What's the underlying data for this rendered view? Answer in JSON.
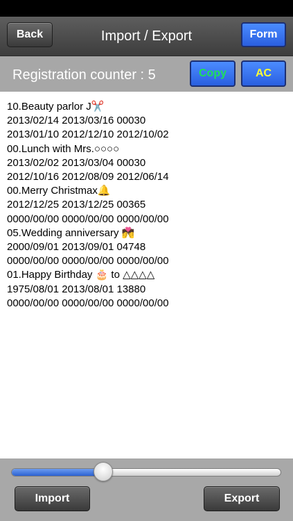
{
  "nav": {
    "back_label": "Back",
    "title": "Import / Export",
    "form_label": "Form"
  },
  "counter": {
    "label": "Registration counter : 5",
    "copy_label": "Copy",
    "ac_label": "AC"
  },
  "content": {
    "text": "10.Beauty parlor J✂️\n2013/02/14 2013/03/16 00030\n2013/01/10 2012/12/10 2012/10/02\n00.Lunch with Mrs.○○○○\n2013/02/02 2013/03/04 00030\n2012/10/16 2012/08/09 2012/06/14\n00.Merry Christmax🔔\n2012/12/25 2013/12/25 00365\n0000/00/00 0000/00/00 0000/00/00\n05.Wedding anniversary 💏\n2000/09/01 2013/09/01 04748\n0000/00/00 0000/00/00 0000/00/00\n01.Happy Birthday 🎂 to △△△△\n1975/08/01 2013/08/01 13880\n0000/00/00 0000/00/00 0000/00/00"
  },
  "slider": {
    "value_fraction": 0.34
  },
  "footer": {
    "import_label": "Import",
    "export_label": "Export"
  },
  "colors": {
    "copy_text": "#1ee05a",
    "ac_text": "#ffff33",
    "accent_blue": "#3473f0"
  }
}
